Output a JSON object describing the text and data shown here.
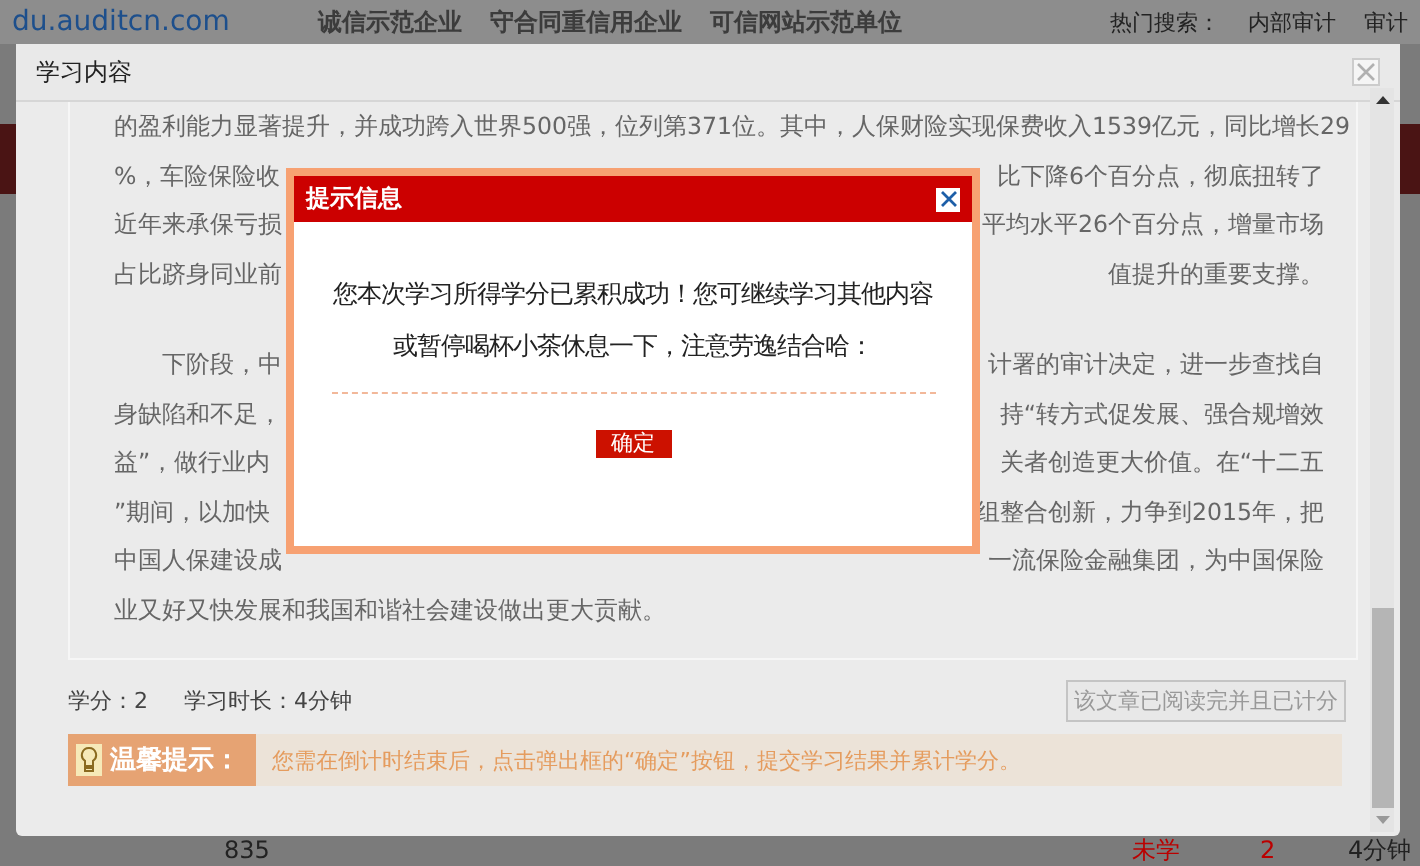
{
  "background_page": {
    "site_url": "du.auditcn.com",
    "badges": [
      "诚信示范企业",
      "守合同重信用企业",
      "可信网站示范单位"
    ],
    "hot_search_label": "热门搜索：",
    "hot_search_links": [
      "内部审计",
      "审计"
    ],
    "table_row": [
      "835",
      "未学",
      "2",
      "4分钟"
    ]
  },
  "study_window": {
    "title": "学习内容",
    "article_paragraphs": [
      {
        "lines": [
          {
            "left": "的盈利能力显著提升，并成功跨入世界500强，位列第371位。其中，人保财险实现保费收入1539亿元，同比增长29"
          },
          {
            "left": "%，车险保险收",
            "right": "比下降6个百分点，彻底扭转了"
          },
          {
            "left": "近年来承保亏损",
            "right": "平均水平26个百分点，增量市场"
          },
          {
            "left": "占比跻身同业前",
            "right": "值提升的重要支撑。"
          }
        ]
      },
      {
        "lines": [
          {
            "left": "下阶段，中",
            "right": "计署的审计决定，进一步查找自"
          },
          {
            "left": "身缺陷和不足，",
            "right": "持“转方式促发展、强合规增效"
          },
          {
            "left": "益”，做行业内",
            "right": "关者创造更大价值。在“十二五"
          },
          {
            "left": "”期间，以加快",
            "right": "组整合创新，力争到2015年，把"
          },
          {
            "left": "中国人保建设成",
            "right": "一流保险金融集团，为中国保险"
          },
          {
            "left": "业又好又快发展和我国和谐社会建设做出更大贡献。"
          }
        ]
      }
    ],
    "credits": "学分：2",
    "duration": "学习时长：4分钟",
    "read_button": {
      "label": "该文章已阅读完并且已计分",
      "disabled": true
    },
    "tip_label": "温馨提示：",
    "tip_text": "您需在倒计时结束后，点击弹出框的“确定”按钮，提交学习结果并累计学分。"
  },
  "alert": {
    "title": "提示信息",
    "message_lines": [
      "您本次学习所得学分已累积成功！您可继续学习其他内容",
      "或暂停喝杯小茶休息一下，注意劳逸结合哈："
    ],
    "ok_button": "确定"
  }
}
